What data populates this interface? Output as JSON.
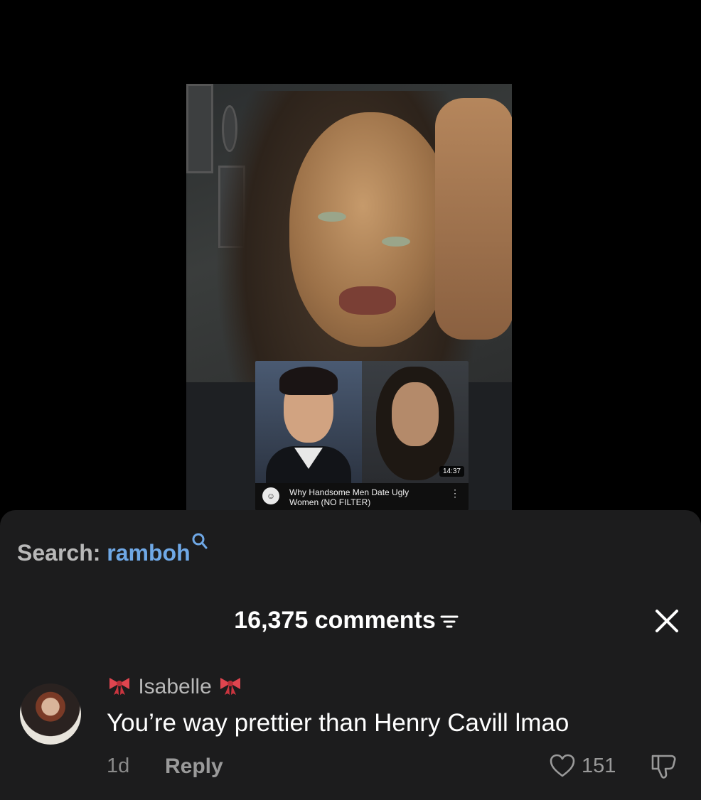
{
  "video": {
    "embedded_thumbnail": {
      "duration": "14:37",
      "title": "Why Handsome Men Date Ugly Women (NO FILTER)"
    }
  },
  "search": {
    "label": "Search:",
    "term": "ramboh"
  },
  "comments": {
    "count_label": "16,375 comments"
  },
  "comment": {
    "username": "Isabelle",
    "text": "You’re way prettier than Henry Cavill lmao",
    "time": "1d",
    "reply_label": "Reply",
    "likes": "151"
  },
  "colors": {
    "sheet_bg": "#1c1c1d",
    "search_term": "#6fa8e6",
    "muted_text": "#9a9a9a"
  }
}
